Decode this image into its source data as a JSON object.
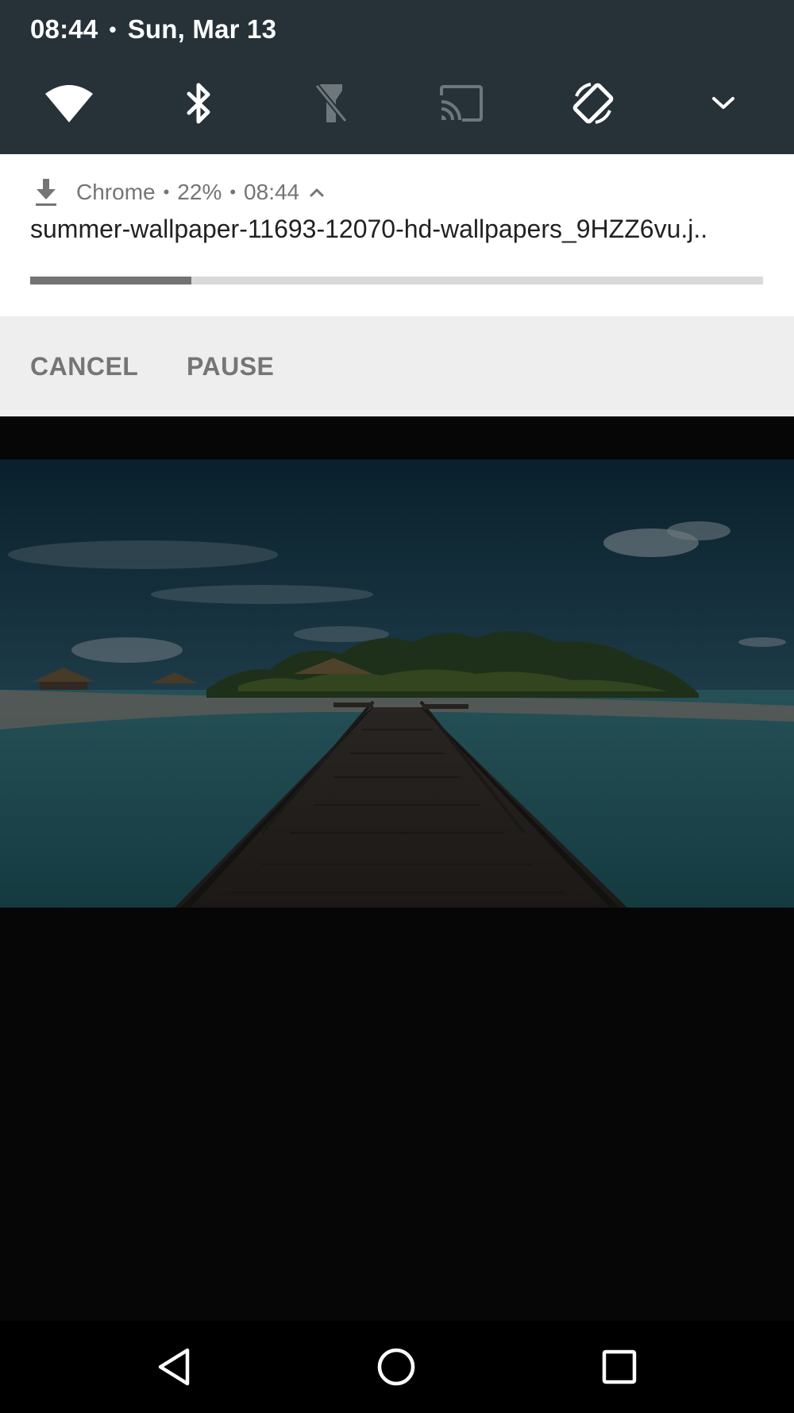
{
  "status": {
    "time": "08:44",
    "separator": "•",
    "date": "Sun, Mar 13"
  },
  "quick_settings": {
    "tiles": [
      {
        "icon": "wifi-icon",
        "state": "on"
      },
      {
        "icon": "bluetooth-icon",
        "state": "on"
      },
      {
        "icon": "flashlight-icon",
        "state": "off"
      },
      {
        "icon": "cast-icon",
        "state": "off"
      },
      {
        "icon": "auto-rotate-icon",
        "state": "on"
      },
      {
        "icon": "chevron-down-icon",
        "state": "expand"
      }
    ]
  },
  "notification": {
    "app_icon": "download-icon",
    "app_name": "Chrome",
    "sep1": "•",
    "progress_text": "22%",
    "sep2": "•",
    "time": "08:44",
    "expand_icon": "chevron-up-icon",
    "title": "summer-wallpaper-11693-12070-hd-wallpapers_9HZZ6vu.j..",
    "progress": 0.22,
    "actions": {
      "cancel": "CANCEL",
      "pause": "PAUSE"
    }
  },
  "wallpaper": {
    "subject": "pier-to-tropical-island-image"
  },
  "navbar": {
    "back": "back-icon",
    "home": "home-icon",
    "recents": "recents-icon"
  },
  "colors": {
    "shade_bg": "#263238",
    "notification_bg": "#ffffff",
    "actions_bg": "#eeeeee",
    "progress_fill": "#737373",
    "progress_track": "#d9d9d9",
    "background": "#060606"
  }
}
